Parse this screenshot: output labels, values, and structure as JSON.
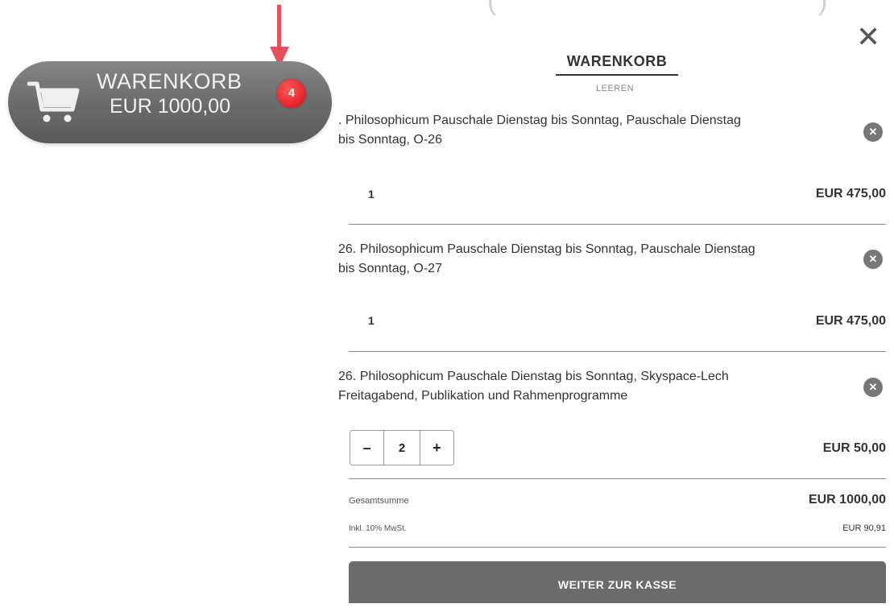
{
  "decor": {
    "paren_left": "(",
    "paren_right": ")"
  },
  "cart_pill": {
    "title": "WARENKORB",
    "total": "EUR 1000,00",
    "badge_count": "4",
    "icon": "shopping-cart-icon"
  },
  "panel": {
    "title": "WARENKORB",
    "clear_label": "LEEREN",
    "close_icon": "✕",
    "remove_icon": "✕"
  },
  "items": [
    {
      "name_line1": ". Philosophicum Pauschale Dienstag bis Sonntag, Pauschale Dienstag",
      "name_line2": "bis Sonntag, O-26",
      "qty": "1",
      "price": "EUR 475,00"
    },
    {
      "name_line1": "26. Philosophicum Pauschale Dienstag bis Sonntag, Pauschale Dienstag",
      "name_line2": "bis Sonntag, O-27",
      "qty": "1",
      "price": "EUR 475,00"
    },
    {
      "name_line1": "26. Philosophicum Pauschale Dienstag bis Sonntag, Skyspace-Lech",
      "name_line2": "Freitagabend, Publikation und Rahmenprogramme",
      "qty": "2",
      "price": "EUR 50,00",
      "minus": "–",
      "plus": "+"
    }
  ],
  "summary": {
    "total_label": "Gesamtsumme",
    "total_value": "EUR 1000,00",
    "tax_label": "Inkl. 10% MwSt.",
    "tax_value": "EUR 90,91"
  },
  "checkout_label": "WEITER ZUR KASSE",
  "colors": {
    "accent_red": "#e4505c",
    "badge_red": "#e3202a",
    "button_gray": "#6b6b6b"
  }
}
